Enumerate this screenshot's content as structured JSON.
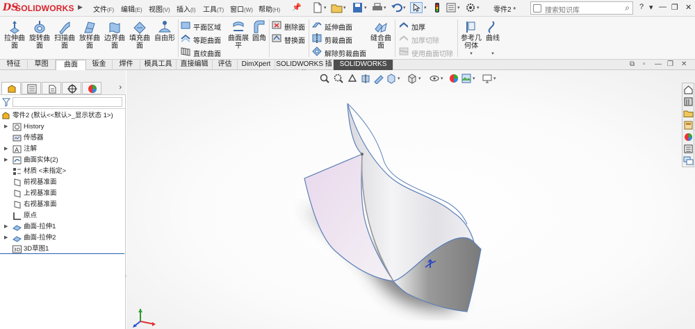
{
  "app": {
    "logo_prefix": "DS",
    "logo_text": "SOLIDWORKS",
    "menus": [
      {
        "label": "文件",
        "key": "(F)"
      },
      {
        "label": "编辑",
        "key": "(E)"
      },
      {
        "label": "视图",
        "key": "(V)"
      },
      {
        "label": "插入",
        "key": "(I)"
      },
      {
        "label": "工具",
        "key": "(T)"
      },
      {
        "label": "窗口",
        "key": "(W)"
      },
      {
        "label": "帮助",
        "key": "(H)"
      }
    ],
    "document_name": "零件2 *",
    "search_placeholder": "搜索知识库",
    "title_controls": [
      "?",
      "▾",
      "—",
      "❐",
      "✕"
    ]
  },
  "ribbon": {
    "large_buttons": [
      {
        "label1": "拉伸曲",
        "label2": "面",
        "icon": "extruded-surface-icon"
      },
      {
        "label1": "旋转曲",
        "label2": "面",
        "icon": "revolved-surface-icon"
      },
      {
        "label1": "扫描曲",
        "label2": "面",
        "icon": "swept-surface-icon"
      },
      {
        "label1": "放样曲",
        "label2": "面",
        "icon": "lofted-surface-icon"
      },
      {
        "label1": "边界曲",
        "label2": "面",
        "icon": "boundary-surface-icon"
      },
      {
        "label1": "填充曲",
        "label2": "面",
        "icon": "filled-surface-icon"
      },
      {
        "label1": "自由形",
        "label2": "",
        "icon": "freeform-icon"
      }
    ],
    "group2": [
      {
        "label": "平面区域",
        "icon": "planar-surface-icon"
      },
      {
        "label": "等距曲面",
        "icon": "offset-surface-icon"
      },
      {
        "label": "直纹曲面",
        "icon": "ruled-surface-icon"
      }
    ],
    "flatten": {
      "label1": "曲面展",
      "label2": "平"
    },
    "fillet": {
      "label": "圆角"
    },
    "group3": [
      {
        "label": "删除面",
        "icon": "delete-face-icon"
      },
      {
        "label": "替换面",
        "icon": "replace-face-icon"
      }
    ],
    "group4": [
      {
        "label": "延伸曲面",
        "icon": "extend-surface-icon"
      },
      {
        "label": "剪裁曲面",
        "icon": "trim-surface-icon"
      },
      {
        "label": "解除剪裁曲面",
        "icon": "untrim-surface-icon"
      }
    ],
    "knit": {
      "label1": "缝合曲",
      "label2": "面"
    },
    "group5": [
      {
        "label": "加厚",
        "icon": "thicken-icon",
        "disabled": false
      },
      {
        "label": "加厚切除",
        "icon": "thicken-cut-icon",
        "disabled": true
      },
      {
        "label": "使用曲面切除",
        "icon": "surface-cut-icon",
        "disabled": true
      }
    ],
    "ref_geometry": {
      "label1": "参考几",
      "label2": "何体"
    },
    "curves": {
      "label": "曲线"
    }
  },
  "tabs": [
    {
      "label": "特征"
    },
    {
      "label": "草图"
    },
    {
      "label": "曲面",
      "active": true
    },
    {
      "label": "钣金"
    },
    {
      "label": "焊件"
    },
    {
      "label": "模具工具"
    },
    {
      "label": "直接编辑"
    },
    {
      "label": "评估"
    },
    {
      "label": "DimXpert"
    },
    {
      "label": "SOLIDWORKS 插件"
    },
    {
      "label": "SOLIDWORKS MBD",
      "dark": true
    }
  ],
  "tree": {
    "root": "零件2 (默认<<默认>_显示状态 1>)",
    "items": [
      {
        "label": "History",
        "expandable": true,
        "icon": "history-icon"
      },
      {
        "label": "传感器",
        "expandable": false,
        "icon": "sensor-icon"
      },
      {
        "label": "注解",
        "expandable": true,
        "icon": "annotation-icon"
      },
      {
        "label": "曲面实体(2)",
        "expandable": true,
        "icon": "surface-bodies-icon"
      },
      {
        "label": "材质 <未指定>",
        "expandable": false,
        "icon": "material-icon"
      },
      {
        "label": "前视基准面",
        "expandable": false,
        "icon": "plane-icon"
      },
      {
        "label": "上视基准面",
        "expandable": false,
        "icon": "plane-icon"
      },
      {
        "label": "右视基准面",
        "expandable": false,
        "icon": "plane-icon"
      },
      {
        "label": "原点",
        "expandable": false,
        "icon": "origin-icon"
      },
      {
        "label": "曲面-拉伸1",
        "expandable": true,
        "icon": "extrude-feature-icon"
      },
      {
        "label": "曲面-拉伸2",
        "expandable": true,
        "icon": "extrude-feature-icon"
      },
      {
        "label": "3D草图1",
        "expandable": false,
        "icon": "3d-sketch-icon"
      }
    ]
  },
  "colors": {
    "brand_red": "#d8242c",
    "accent_blue": "#2b5fb3",
    "dark_tab": "#4d4d4d"
  }
}
